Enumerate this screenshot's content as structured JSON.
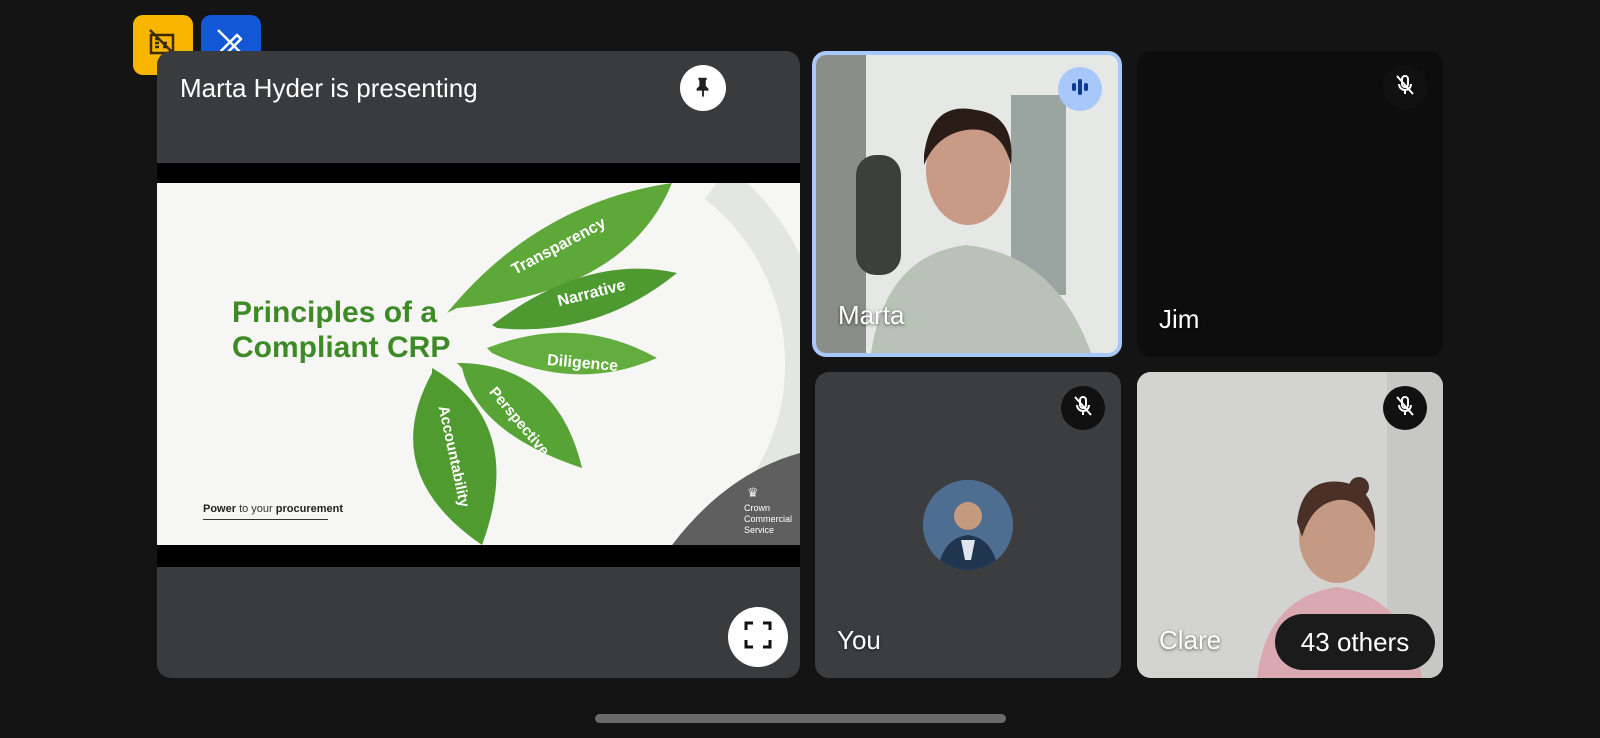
{
  "toolbar": {
    "left_icon": "camera-off-grid-icon",
    "right_icon": "pen-edit-icon"
  },
  "presentation": {
    "title": "Marta Hyder is presenting",
    "pin_icon": "pin-icon",
    "fullscreen_icon": "fullscreen-icon",
    "slide": {
      "title_line1": "Principles of a",
      "title_line2": "Compliant CRP",
      "leaves": [
        "Transparency",
        "Narrative",
        "Diligence",
        "Perspective",
        "Accountability"
      ],
      "footer_bold1": "Power",
      "footer_mid": " to your ",
      "footer_bold2": "procurement",
      "logo_lines": [
        "Crown",
        "Commercial",
        "Service"
      ]
    }
  },
  "participants": [
    {
      "name": "Marta",
      "status": "speaking"
    },
    {
      "name": "Jim",
      "status": "muted"
    },
    {
      "name": "You",
      "status": "muted"
    },
    {
      "name": "Clare",
      "status": "muted"
    }
  ],
  "others_label": "43 others",
  "colors": {
    "background": "#141414",
    "tile": "#3c3d3f",
    "speaking_border": "#a8c7fa",
    "slide_green": "#3e8a26",
    "yellow_button": "#f7b500",
    "blue_button": "#1257d6"
  }
}
